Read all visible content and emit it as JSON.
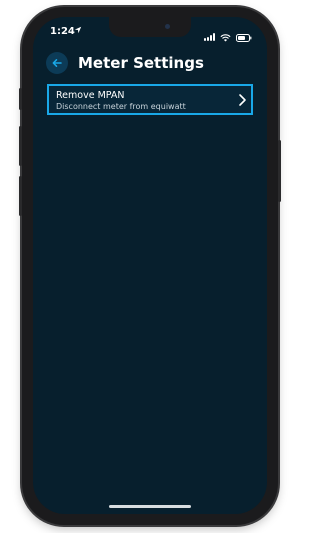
{
  "status_bar": {
    "time": "1:24",
    "location_icon": "location-arrow-icon",
    "signal_icon": "signal-bars-icon",
    "wifi_icon": "wifi-icon",
    "battery_icon": "battery-icon"
  },
  "header": {
    "back_icon": "arrow-left-icon",
    "title": "Meter Settings"
  },
  "settings": {
    "items": [
      {
        "title": "Remove MPAN",
        "subtitle": "Disconnect meter from equiwatt",
        "icon": "chevron-right-icon"
      }
    ]
  },
  "colors": {
    "screen_bg": "#071f2d",
    "accent": "#19a8e8",
    "back_button_bg": "#0c3b57"
  }
}
